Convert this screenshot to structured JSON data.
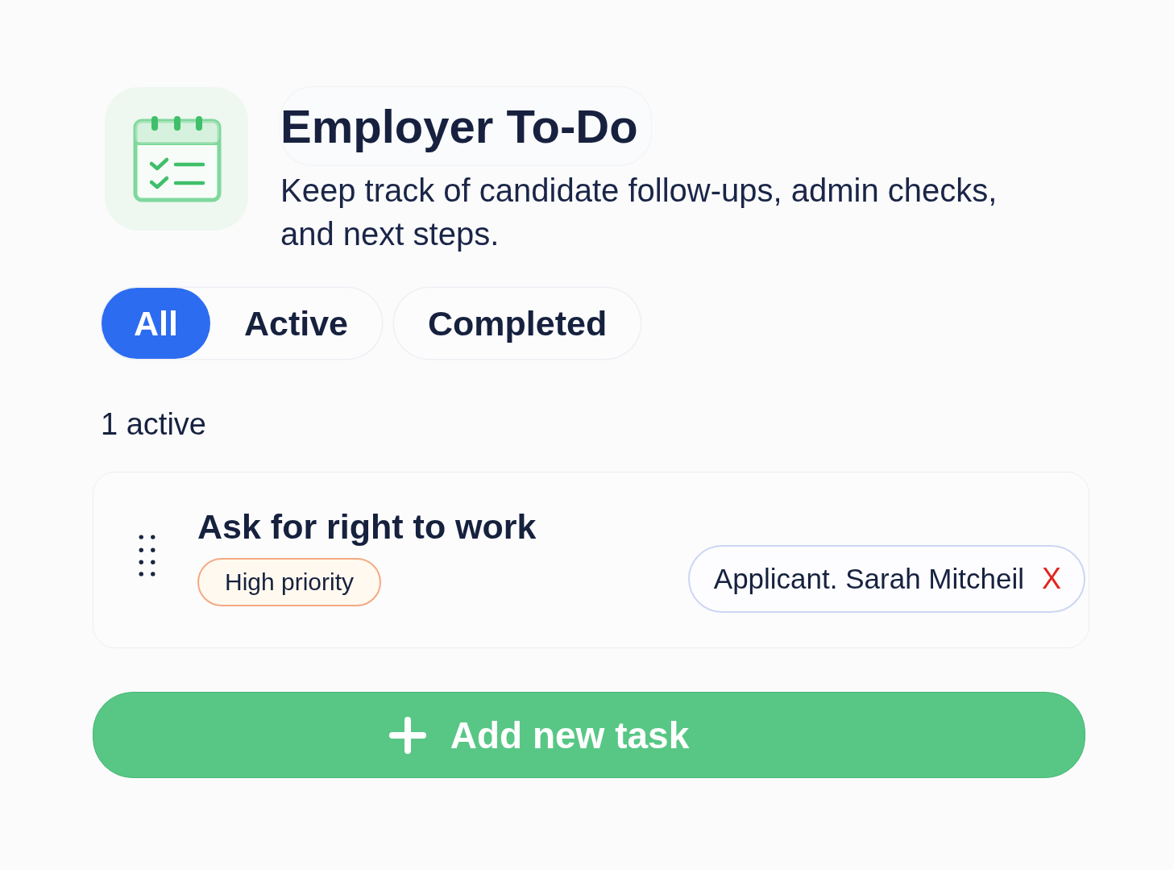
{
  "header": {
    "title": "Employer To-Do",
    "subtitle": "Keep track of candidate follow-ups, admin checks, and next steps."
  },
  "tab_groups": [
    {
      "tabs": [
        {
          "label": "All",
          "selected": true
        },
        {
          "label": "Active",
          "selected": false
        }
      ]
    },
    {
      "tabs": [
        {
          "label": "Completed",
          "selected": false
        }
      ]
    }
  ],
  "summary": "1 active",
  "tasks": [
    {
      "title": "Ask for right to work",
      "priority": "High priority",
      "assignee": "Applicant. Sarah Mitcheil",
      "remove": "X"
    }
  ],
  "add_button": {
    "label": "Add new task"
  }
}
